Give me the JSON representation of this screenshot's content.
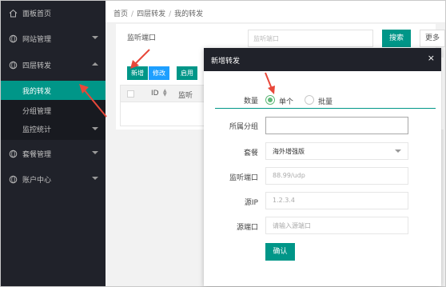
{
  "sidebar": {
    "items": [
      {
        "label": "面板首页",
        "icon": "home-icon"
      },
      {
        "label": "网站管理",
        "icon": "globe-icon"
      },
      {
        "label": "四层转发",
        "icon": "globe-icon"
      },
      {
        "label": "套餐管理",
        "icon": "globe-icon"
      },
      {
        "label": "账户中心",
        "icon": "globe-icon"
      }
    ],
    "subitems": [
      {
        "label": "我的转发"
      },
      {
        "label": "分组管理"
      },
      {
        "label": "监控统计"
      }
    ]
  },
  "breadcrumb": {
    "items": [
      "首页",
      "四层转发",
      "我的转发"
    ],
    "separator": "/"
  },
  "filter": {
    "label": "监听端口",
    "placeholder": "监听端口",
    "search_label": "搜索",
    "more_label": "更多"
  },
  "toolbar": {
    "buttons": [
      {
        "label": "新增",
        "color": "#009688"
      },
      {
        "label": "修改",
        "color": "#1e9fff"
      },
      {
        "label": "启用",
        "color": "#009688"
      }
    ]
  },
  "table": {
    "columns": [
      "ID",
      "监听"
    ]
  },
  "modal": {
    "title": "新增转发",
    "close": "×",
    "fields": {
      "quantity": {
        "label": "数量",
        "options": [
          "单个",
          "批量"
        ],
        "selected": "单个"
      },
      "group": {
        "label": "所属分组",
        "value": ""
      },
      "plan": {
        "label": "套餐",
        "value": "海外增强版"
      },
      "listen_port": {
        "label": "监听端口",
        "placeholder": "88.99/udp"
      },
      "source_ip": {
        "label": "源IP",
        "placeholder": "1.2.3.4"
      },
      "source_port": {
        "label": "源端口",
        "placeholder": "请输入源端口"
      }
    },
    "confirm_label": "确认"
  },
  "colors": {
    "sidebar_bg": "#20222a",
    "accent": "#009688",
    "radio_green": "#5fb878",
    "arrow_red": "#e8483a"
  }
}
